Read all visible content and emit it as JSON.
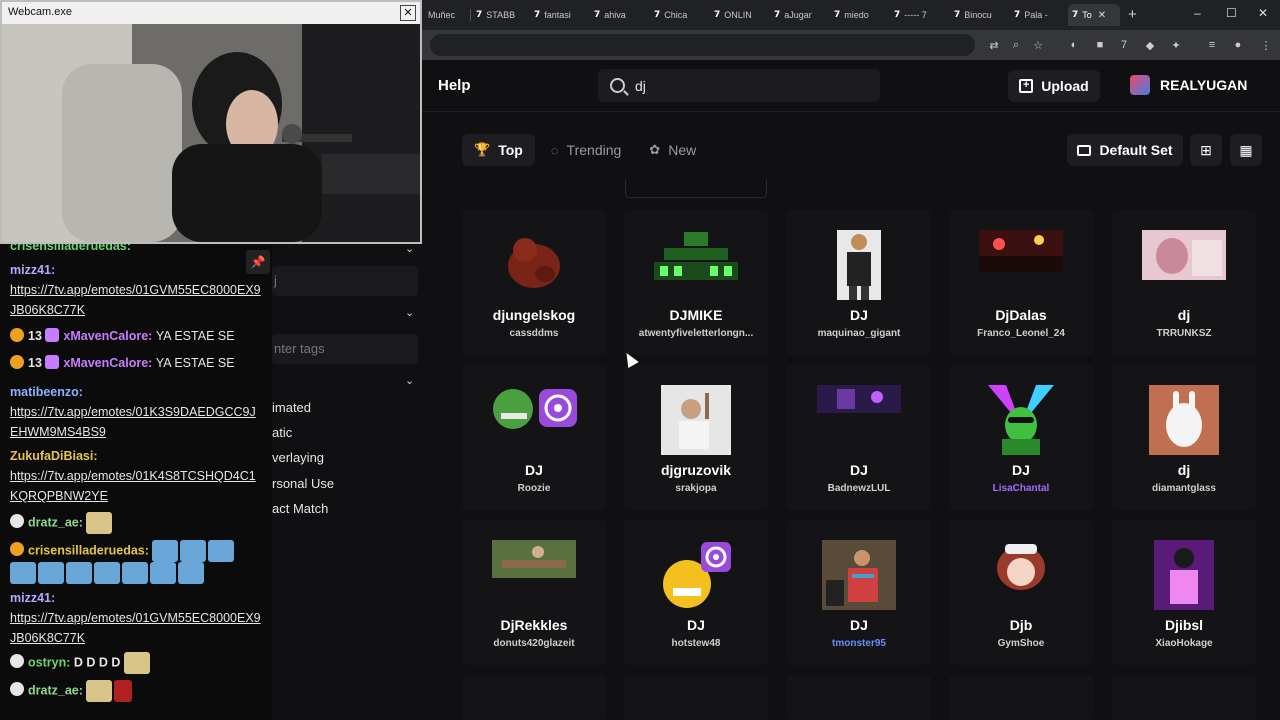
{
  "browser": {
    "tabs": [
      {
        "label": "Muñec",
        "active": false
      },
      {
        "label": "STABB",
        "active": false
      },
      {
        "label": "fantasi",
        "active": false
      },
      {
        "label": "ahiva",
        "active": false
      },
      {
        "label": "Chica",
        "active": false
      },
      {
        "label": "ONLIN",
        "active": false
      },
      {
        "label": "aJugar",
        "active": false
      },
      {
        "label": "miedo",
        "active": false
      },
      {
        "label": "----- 7",
        "active": false
      },
      {
        "label": "Binocu",
        "active": false
      },
      {
        "label": "Pala -",
        "active": false
      },
      {
        "label": "To",
        "active": true
      }
    ],
    "tab_favicon": "7",
    "new_tab": "+",
    "window_controls": {
      "minimize": "–",
      "maximize": "☐",
      "close": "✕"
    }
  },
  "header": {
    "help_label": "Help",
    "search_value": "dj",
    "upload_label": "Upload",
    "username": "REALYUGAN"
  },
  "filters": {
    "top": "Top",
    "trending": "Trending",
    "new": "New"
  },
  "toolbar": {
    "default_set_label": "Default Set"
  },
  "emotes": [
    {
      "name": "djungelskog",
      "owner": "cassddms",
      "owner_color": "default",
      "thumb": "plush"
    },
    {
      "name": "DJMIKE",
      "owner": "atwentyfiveletterlongn...",
      "owner_color": "default",
      "thumb": "green-dj"
    },
    {
      "name": "DJ",
      "owner": "maquinao_gigant",
      "owner_color": "default",
      "thumb": "man-jacket"
    },
    {
      "name": "DjDalas",
      "owner": "Franco_Leonel_24",
      "owner_color": "default",
      "thumb": "club-crowd"
    },
    {
      "name": "dj",
      "owner": "TRRUNKSZ",
      "owner_color": "default",
      "thumb": "pink-photo"
    },
    {
      "name": "DJ",
      "owner": "Roozie",
      "owner_color": "default",
      "thumb": "pepe-disc"
    },
    {
      "name": "djgruzovik",
      "owner": "srakjopa",
      "owner_color": "default",
      "thumb": "man-hammer"
    },
    {
      "name": "DJ",
      "owner": "BadnewzLUL",
      "owner_color": "default",
      "thumb": "purple-stage"
    },
    {
      "name": "DJ",
      "owner": "LisaChantal",
      "owner_color": "purple",
      "thumb": "neon-dj"
    },
    {
      "name": "dj",
      "owner": "diamantglass",
      "owner_color": "default",
      "thumb": "rabbid"
    },
    {
      "name": "DjRekkles",
      "owner": "donuts420glazeit",
      "owner_color": "default",
      "thumb": "outdoor-table"
    },
    {
      "name": "DJ",
      "owner": "hotstew48",
      "owner_color": "default",
      "thumb": "emoji-disc"
    },
    {
      "name": "DJ",
      "owner": "tmonster95",
      "owner_color": "blue",
      "thumb": "poncho-dj"
    },
    {
      "name": "Djb",
      "owner": "GymShoe",
      "owner_color": "default",
      "thumb": "anime-girl"
    },
    {
      "name": "Djibsl",
      "owner": "XiaoHokage",
      "owner_color": "default",
      "thumb": "purple-person"
    }
  ],
  "side_panel": {
    "input_value": "j",
    "tags_placeholder": "nter tags",
    "items": [
      "imated",
      "atic",
      "verlaying",
      "rsonal Use",
      "act Match"
    ]
  },
  "webcam": {
    "title": "Webcam.exe",
    "close": "✕"
  },
  "chat": {
    "top_partial": "crisensilladeruedas:",
    "messages": [
      {
        "user": "mizz41:",
        "user_class": "u1",
        "text": "https://7tv.app/emotes/01GVM55EC8000EX9JB06K8C77K",
        "is_link": true
      },
      {
        "user": "xMavenCalore:",
        "user_class": "u5",
        "text": "YA ESTAE SE",
        "is_link": false
      },
      {
        "user": "xMavenCalore:",
        "user_class": "u5",
        "text": "YA ESTAE SE",
        "is_link": false
      },
      {
        "user": "matibeenzo:",
        "user_class": "u6",
        "text": "https://7tv.app/emotes/01K3S9DAEDGCC9JEHWM9MS4BS9",
        "is_link": true
      },
      {
        "user": "ZukufaDiBiasi:",
        "user_class": "u2",
        "text": "https://7tv.app/emotes/01K4S8TCSHQD4C1KQRQPBNW2YE",
        "is_link": true
      },
      {
        "user": "dratz_ae:",
        "user_class": "u3",
        "text": "",
        "is_link": false
      },
      {
        "user": "crisensilladeruedas:",
        "user_class": "u2",
        "text": "",
        "is_link": false
      },
      {
        "user": "mizz41:",
        "user_class": "u1",
        "text": "https://7tv.app/emotes/01GVM55EC8000EX9JB06K8C77K",
        "is_link": true
      },
      {
        "user": "ostryn:",
        "user_class": "u3",
        "text": "D D D D",
        "is_link": false
      },
      {
        "user": "dratz_ae:",
        "user_class": "u3",
        "text": "",
        "is_link": false
      }
    ],
    "badge_number": "13",
    "pin_icon": "📌"
  },
  "colors": {
    "page_bg": "#101012",
    "card_bg": "#141417",
    "accent_purple": "#a36bff",
    "accent_blue": "#6b8cff"
  }
}
